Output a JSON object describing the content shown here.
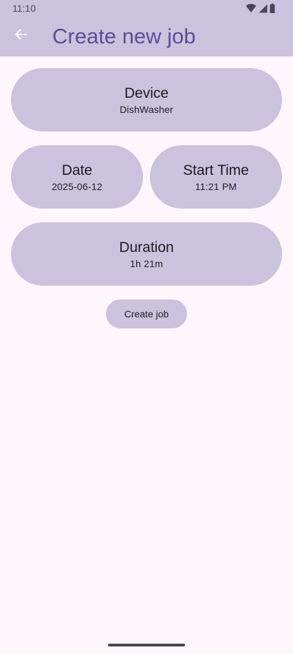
{
  "status_bar": {
    "time": "11:10",
    "icons": [
      "wifi-icon",
      "cellular-signal-icon",
      "battery-icon"
    ]
  },
  "app_bar": {
    "back_icon": "arrow-left-icon",
    "title": "Create new job"
  },
  "form": {
    "device": {
      "label": "Device",
      "value": "DishWasher"
    },
    "date": {
      "label": "Date",
      "value": "2025-06-12"
    },
    "start_time": {
      "label": "Start Time",
      "value": "11:21 PM"
    },
    "duration": {
      "label": "Duration",
      "value": "1h 21m"
    },
    "create_button_label": "Create job"
  },
  "colors": {
    "surface": "#fdf7fd",
    "primary_container": "#cbc2de",
    "title": "#5d4d99",
    "text": "#1d1b20"
  }
}
